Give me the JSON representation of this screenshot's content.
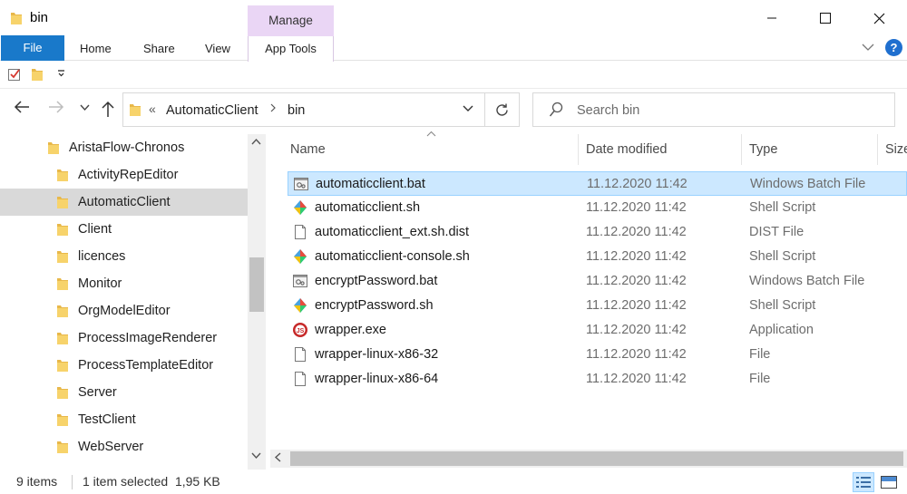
{
  "window": {
    "title": "bin",
    "context_tab_group": "Manage",
    "colors": {
      "accent": "#1979ca",
      "context_group": "#ead6f5",
      "selection": "#cce8ff"
    }
  },
  "ribbon": {
    "tabs": [
      "File",
      "Home",
      "Share",
      "View",
      "App Tools"
    ]
  },
  "address": {
    "overflow": "«",
    "crumbs": [
      "AutomaticClient",
      "bin"
    ]
  },
  "search": {
    "placeholder": "Search bin"
  },
  "nav_tree": [
    {
      "label": "AristaFlow-Chronos",
      "selected": false,
      "level": 0
    },
    {
      "label": "ActivityRepEditor",
      "selected": false,
      "level": 1
    },
    {
      "label": "AutomaticClient",
      "selected": true,
      "level": 1
    },
    {
      "label": "Client",
      "selected": false,
      "level": 1
    },
    {
      "label": "licences",
      "selected": false,
      "level": 1
    },
    {
      "label": "Monitor",
      "selected": false,
      "level": 1
    },
    {
      "label": "OrgModelEditor",
      "selected": false,
      "level": 1
    },
    {
      "label": "ProcessImageRenderer",
      "selected": false,
      "level": 1
    },
    {
      "label": "ProcessTemplateEditor",
      "selected": false,
      "level": 1
    },
    {
      "label": "Server",
      "selected": false,
      "level": 1
    },
    {
      "label": "TestClient",
      "selected": false,
      "level": 1
    },
    {
      "label": "WebServer",
      "selected": false,
      "level": 1
    }
  ],
  "columns": [
    "Name",
    "Date modified",
    "Type",
    "Size"
  ],
  "files": [
    {
      "name": "automaticclient.bat",
      "date": "11.12.2020 11:42",
      "type": "Windows Batch File",
      "icon": "batch-file-icon",
      "selected": true
    },
    {
      "name": "automaticclient.sh",
      "date": "11.12.2020 11:42",
      "type": "Shell Script",
      "icon": "shell-script-icon",
      "selected": false
    },
    {
      "name": "automaticclient_ext.sh.dist",
      "date": "11.12.2020 11:42",
      "type": "DIST File",
      "icon": "generic-file-icon",
      "selected": false
    },
    {
      "name": "automaticclient-console.sh",
      "date": "11.12.2020 11:42",
      "type": "Shell Script",
      "icon": "shell-script-icon",
      "selected": false
    },
    {
      "name": "encryptPassword.bat",
      "date": "11.12.2020 11:42",
      "type": "Windows Batch File",
      "icon": "batch-file-icon",
      "selected": false
    },
    {
      "name": "encryptPassword.sh",
      "date": "11.12.2020 11:42",
      "type": "Shell Script",
      "icon": "shell-script-icon",
      "selected": false
    },
    {
      "name": "wrapper.exe",
      "date": "11.12.2020 11:42",
      "type": "Application",
      "icon": "app-exe-icon",
      "selected": false
    },
    {
      "name": "wrapper-linux-x86-32",
      "date": "11.12.2020 11:42",
      "type": "File",
      "icon": "generic-file-icon",
      "selected": false
    },
    {
      "name": "wrapper-linux-x86-64",
      "date": "11.12.2020 11:42",
      "type": "File",
      "icon": "generic-file-icon",
      "selected": false
    }
  ],
  "status": {
    "item_count": "9 items",
    "selection": "1 item selected  1,95 KB"
  }
}
